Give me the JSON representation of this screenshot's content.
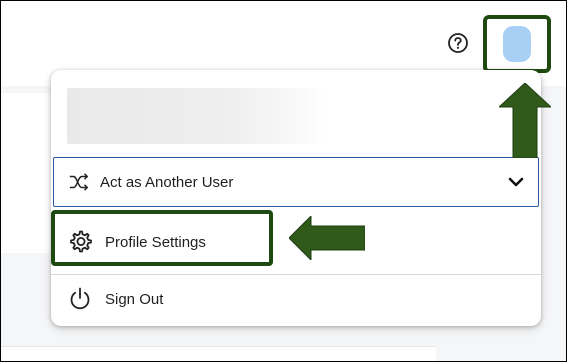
{
  "header": {
    "help_icon": "help-circle-icon",
    "avatar_color": "#a8d0f5"
  },
  "menu": {
    "act_as_user": {
      "label": "Act as Another User",
      "icon": "shuffle-icon",
      "chevron": "chevron-down-icon"
    },
    "profile_settings": {
      "label": "Profile Settings",
      "icon": "gear-icon"
    },
    "sign_out": {
      "label": "Sign Out",
      "icon": "power-icon"
    }
  },
  "annotations": {
    "highlight_color": "#1e4a12",
    "arrow_color": "#2f5a1a"
  },
  "colors": {
    "focus_border": "#2c5aa0"
  }
}
